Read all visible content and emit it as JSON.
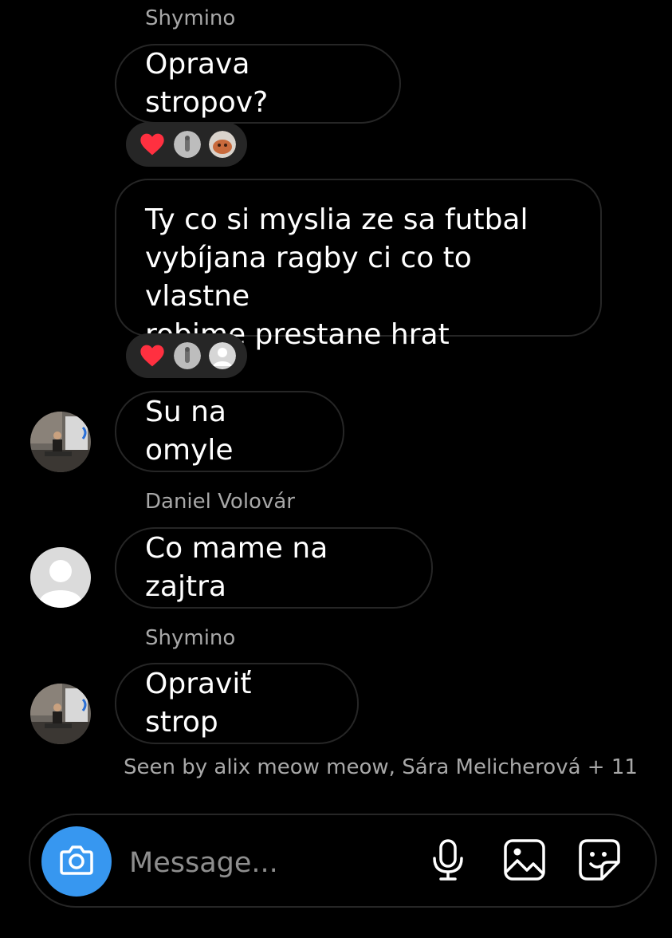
{
  "messages": [
    {
      "sender": "Shymino",
      "text": "Oprava stropov?",
      "reactions": [
        "heart-icon",
        "reactor-avatar",
        "reactor-avatar"
      ]
    },
    {
      "text": "Ty co si myslia ze sa futbal\nvybíjana ragby ci co to vlastne\nrobime prestane hrat",
      "reactions": [
        "heart-icon",
        "reactor-avatar",
        "reactor-avatar"
      ]
    },
    {
      "text": "Su na omyle"
    },
    {
      "sender": "Daniel Volovár",
      "text": "Co mame na zajtra"
    },
    {
      "sender": "Shymino",
      "text": "Opraviť strop"
    }
  ],
  "seen_text": "Seen by alix meow meow, Sára Melicherová + 11",
  "composer": {
    "placeholder": "Message...",
    "icons": [
      "camera-icon",
      "microphone-icon",
      "gallery-icon",
      "sticker-icon"
    ]
  },
  "colors": {
    "background": "#000000",
    "bubble_border": "#262626",
    "secondary_text": "#a8a8a8",
    "accent": "#3797f0",
    "heart": "#ff3040"
  }
}
